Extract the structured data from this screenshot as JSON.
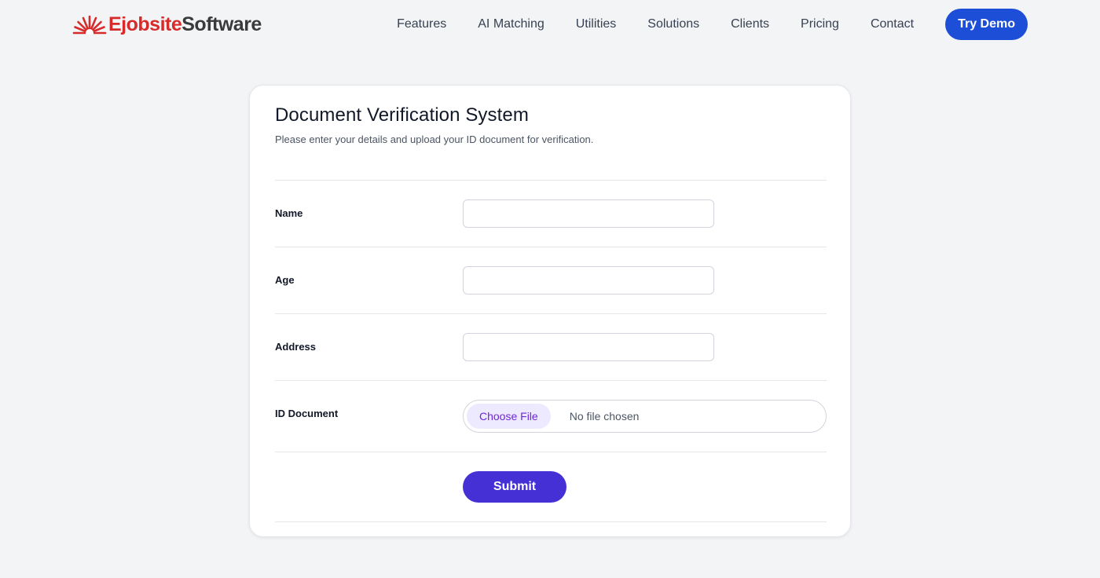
{
  "brand": {
    "name_part1": "Ejobsite",
    "name_part2": "Software",
    "icon": "sunburst-logo-icon",
    "colors": {
      "red": "#d72a2a",
      "dark": "#3a3a3a"
    }
  },
  "nav": {
    "items": [
      {
        "label": "Features"
      },
      {
        "label": "AI Matching"
      },
      {
        "label": "Utilities"
      },
      {
        "label": "Solutions"
      },
      {
        "label": "Clients"
      },
      {
        "label": "Pricing"
      },
      {
        "label": "Contact"
      }
    ],
    "cta_label": "Try Demo",
    "cta_color": "#1d4ed8"
  },
  "form": {
    "title": "Document Verification System",
    "subtitle": "Please enter your details and upload your ID document for verification.",
    "fields": [
      {
        "label": "Name",
        "value": "",
        "placeholder": ""
      },
      {
        "label": "Age",
        "value": "",
        "placeholder": ""
      },
      {
        "label": "Address",
        "value": "",
        "placeholder": ""
      }
    ],
    "file_field": {
      "label": "ID Document",
      "button_label": "Choose File",
      "status": "No file chosen"
    },
    "submit_label": "Submit",
    "submit_color": "#4530d6"
  }
}
